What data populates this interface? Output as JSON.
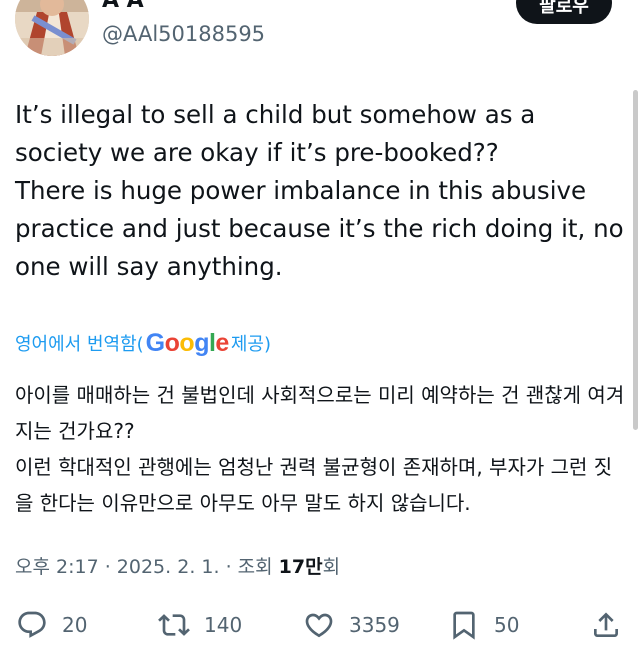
{
  "user": {
    "display_name": "A A",
    "handle": "@AAl50188595"
  },
  "follow_button": {
    "label": "팔로우"
  },
  "tweet": {
    "text": "It’s illegal to sell a child but somehow as a society we are okay if it’s pre-booked??\nThere is huge power imbalance in this abusive practice and just because it’s the rich doing it, no one will say anything."
  },
  "translation": {
    "prefix": "영어에서 번역함(",
    "google": {
      "G": "G",
      "o1": "o",
      "o2": "o",
      "g": "g",
      "l": "l",
      "e": "e"
    },
    "suffix": " 제공)",
    "text": "아이를 매매하는 건 불법인데 사회적으로는 미리 예약하는 건 괜찮게 여겨지는 건가요??\n이런 학대적인 관행에는 엄청난 권력 불균형이 존재하며, 부자가 그런 짓을 한다는 이유만으로 아무도 아무 말도 하지 않습니다."
  },
  "meta": {
    "time": "오후 2:17",
    "sep1": " · ",
    "date": "2025. 2. 1.",
    "sep2": " · ",
    "views_label": "조회 ",
    "views_count": "17만",
    "views_suffix": "회"
  },
  "actions": {
    "reply_count": "20",
    "retweet_count": "140",
    "like_count": "3359",
    "bookmark_count": "50"
  },
  "icons": {
    "reply": "reply-icon",
    "retweet": "retweet-icon",
    "like": "heart-icon",
    "bookmark": "bookmark-icon",
    "share": "share-icon"
  },
  "colors": {
    "text": "#0f1419",
    "secondary": "#536471",
    "link": "#1d9bf0",
    "button_bg": "#0f1419"
  }
}
